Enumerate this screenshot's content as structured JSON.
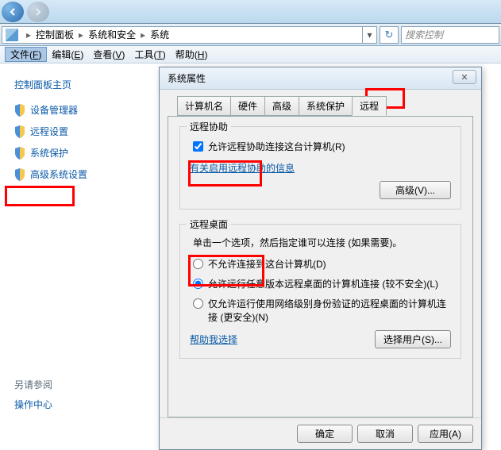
{
  "addressbar": {
    "crumbs": [
      "控制面板",
      "系统和安全",
      "系统"
    ],
    "search_placeholder": "搜索控制"
  },
  "menubar": {
    "items": [
      {
        "label": "文件",
        "hotkey": "F"
      },
      {
        "label": "编辑",
        "hotkey": "E"
      },
      {
        "label": "查看",
        "hotkey": "V"
      },
      {
        "label": "工具",
        "hotkey": "T"
      },
      {
        "label": "帮助",
        "hotkey": "H"
      }
    ]
  },
  "sidebar": {
    "title": "控制面板主页",
    "items": [
      {
        "label": "设备管理器"
      },
      {
        "label": "远程设置"
      },
      {
        "label": "系统保护"
      },
      {
        "label": "高级系统设置"
      }
    ],
    "see_also_title": "另请参阅",
    "see_also_link": "操作中心"
  },
  "dialog": {
    "title": "系统属性",
    "tabs": [
      "计算机名",
      "硬件",
      "高级",
      "系统保护",
      "远程"
    ],
    "active_tab": 4,
    "remote_assist": {
      "group_title": "远程协助",
      "checkbox_label": "允许远程协助连接这台计算机(R)",
      "checkbox_checked": true,
      "link": "有关启用远程协助的信息",
      "advanced_btn": "高级(V)..."
    },
    "remote_desktop": {
      "group_title": "远程桌面",
      "desc": "单击一个选项，然后指定谁可以连接 (如果需要)。",
      "options": [
        {
          "label": "不允许连接到这台计算机(D)"
        },
        {
          "label": "允许运行任意版本远程桌面的计算机连接 (较不安全)(L)"
        },
        {
          "label": "仅允许运行使用网络级别身份验证的远程桌面的计算机连接 (更安全)(N)"
        }
      ],
      "selected": 1,
      "help_link": "帮助我选择",
      "select_users_btn": "选择用户(S)..."
    },
    "buttons": {
      "ok": "确定",
      "cancel": "取消",
      "apply": "应用(A)"
    }
  }
}
